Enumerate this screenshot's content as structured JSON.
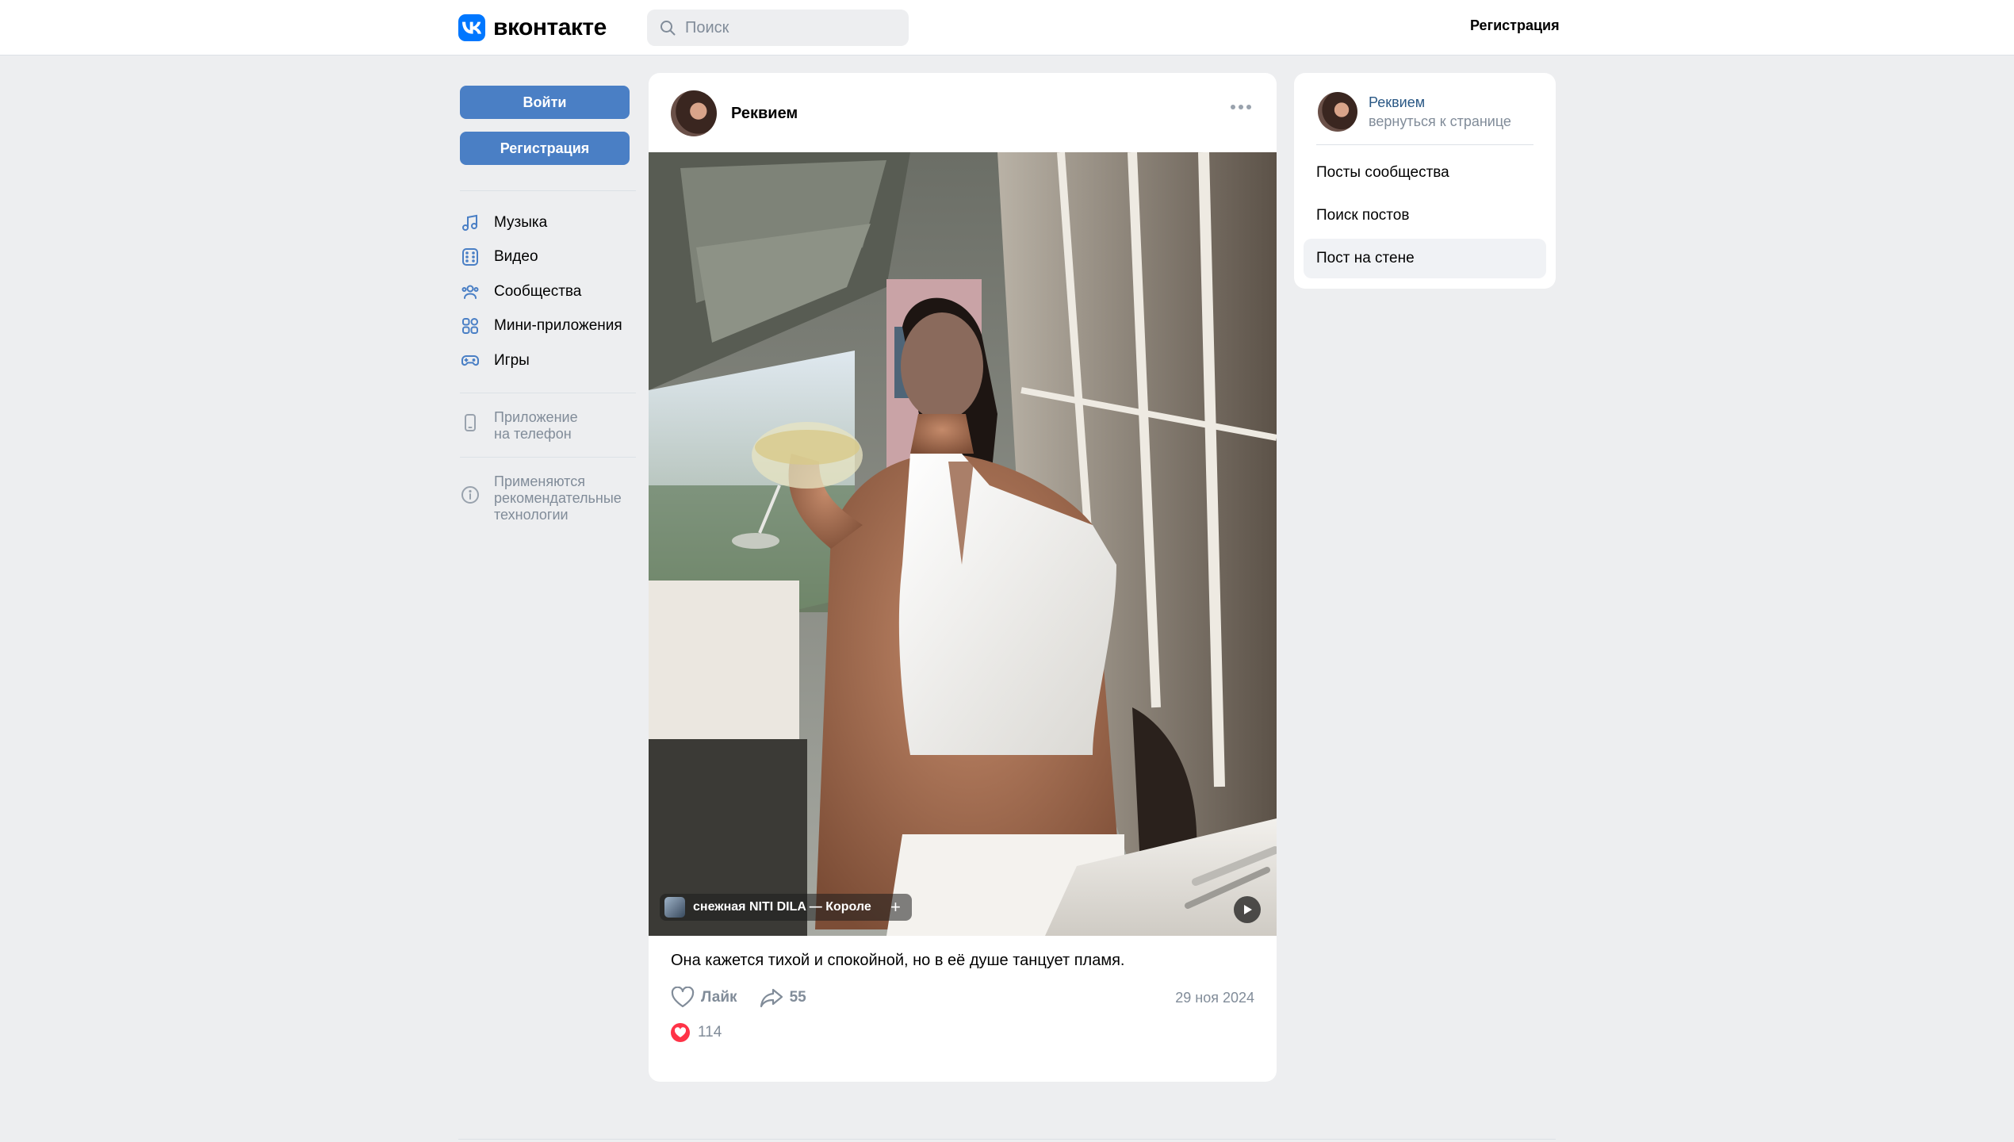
{
  "header": {
    "logo_text": "вконтакте",
    "search_placeholder": "Поиск",
    "register_link": "Регистрация"
  },
  "left": {
    "login_button": "Войти",
    "register_button": "Регистрация",
    "menu": [
      {
        "label": "Музыка",
        "icon": "music-icon"
      },
      {
        "label": "Видео",
        "icon": "video-icon"
      },
      {
        "label": "Сообщества",
        "icon": "communities-icon"
      },
      {
        "label": "Мини-приложения",
        "icon": "mini-apps-icon"
      },
      {
        "label": "Игры",
        "icon": "games-icon"
      }
    ],
    "app_note": "Приложение\nна телефон",
    "recommend_note": "Применяются\nрекомендательные\nтехнологии"
  },
  "post": {
    "author": "Реквием",
    "music_track": "снежная   NITI DILA — Короле",
    "text": "Она кажется тихой и спокойной, но в её душе танцует пламя.",
    "like_label": "Лайк",
    "share_count": "55",
    "date": "29 ноя 2024",
    "reactions_count": "114"
  },
  "right": {
    "name": "Реквием",
    "back_label": "вернуться к странице",
    "items": [
      {
        "label": "Посты сообщества"
      },
      {
        "label": "Поиск постов"
      },
      {
        "label": "Пост на стене"
      }
    ]
  },
  "colors": {
    "accent": "#4a7fc5",
    "brand": "#0077ff",
    "background": "#edeef0",
    "muted_text": "#818c99",
    "link": "#2a5885",
    "heart": "#ff3347"
  }
}
